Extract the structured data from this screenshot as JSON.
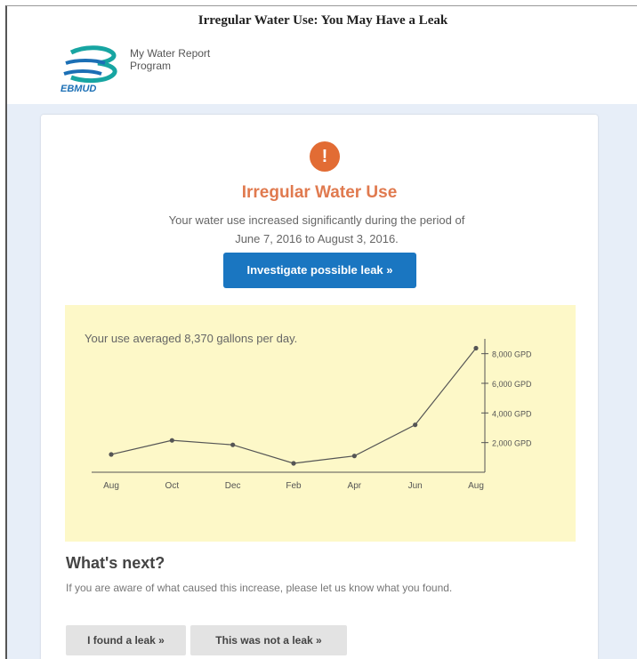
{
  "email": {
    "subject": "Irregular Water Use: You May Have a Leak"
  },
  "header": {
    "logo_text": "EBMUD",
    "program_line1": "My Water Report",
    "program_line2": "Program"
  },
  "alert": {
    "icon": "exclamation-icon",
    "icon_glyph": "!",
    "title": "Irregular Water Use",
    "desc_line1": "Your water use increased significantly during the period of",
    "desc_line2": "June 7, 2016 to August 3, 2016.",
    "cta_label": "Investigate possible leak »"
  },
  "usage": {
    "average_text": "Your use averaged 8,370 gallons per day."
  },
  "chart_data": {
    "type": "line",
    "categories": [
      "Aug",
      "Oct",
      "Dec",
      "Feb",
      "Apr",
      "Jun",
      "Aug"
    ],
    "values": [
      1200,
      2150,
      1850,
      600,
      1100,
      3200,
      8370
    ],
    "ytick_labels": [
      "2,000 GPD",
      "4,000 GPD",
      "6,000 GPD",
      "8,000 GPD"
    ],
    "yticks": [
      2000,
      4000,
      6000,
      8000
    ],
    "ylim": [
      0,
      9000
    ],
    "axis_position": "right",
    "grid": false,
    "colors": {
      "background": "#fdf8c8",
      "line": "#555555",
      "axis": "#555555"
    }
  },
  "next": {
    "title": "What's next?",
    "desc": "If you are aware of what caused this increase, please let us know what you found.",
    "found_leak_label": "I found a leak »",
    "not_leak_label": "This was not a leak »"
  },
  "colors": {
    "accent": "#e26c34",
    "primary_button": "#1a76c1",
    "page_background": "#e7eef8"
  }
}
